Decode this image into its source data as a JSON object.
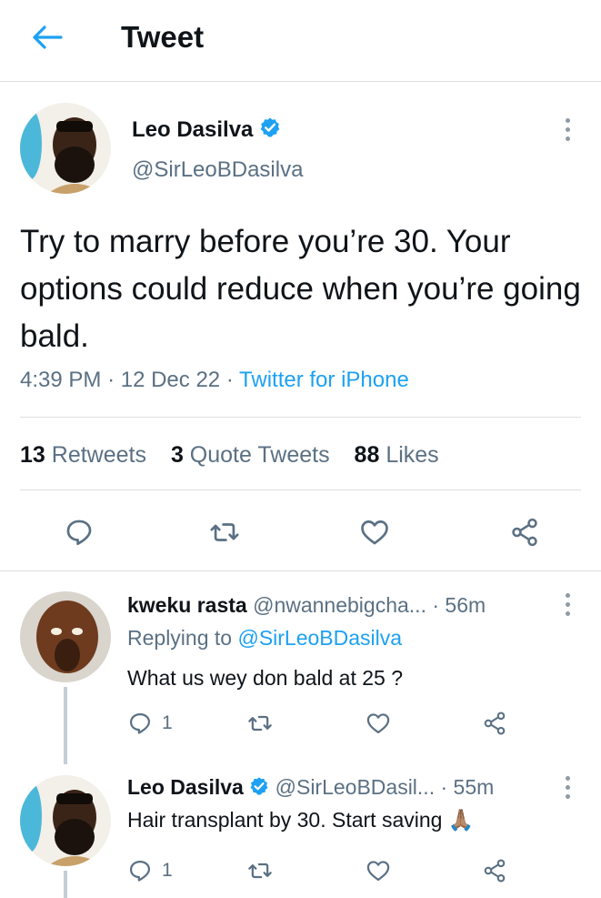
{
  "header": {
    "title": "Tweet"
  },
  "tweet": {
    "author_name": "Leo Dasilva",
    "author_handle": "@SirLeoBDasilva",
    "text": "Try to marry before you’re 30. Your options could reduce when you’re going bald.",
    "time": "4:39 PM",
    "date": "12 Dec 22",
    "sep": "·",
    "source": "Twitter for iPhone",
    "stats": {
      "retweets_count": "13",
      "retweets_label": "Retweets",
      "quotes_count": "3",
      "quotes_label": "Quote Tweets",
      "likes_count": "88",
      "likes_label": "Likes"
    }
  },
  "replies": [
    {
      "name": "kweku rasta",
      "handle": "@nwannebigcha...",
      "time": "· 56m",
      "replying_prefix": "Replying to",
      "replying_to": "@SirLeoBDasilva",
      "text": "What us wey don bald at 25 ?",
      "reply_count": "1"
    },
    {
      "name": "Leo Dasilva",
      "handle": "@SirLeoBDasil...",
      "time": "· 55m",
      "text": "Hair transplant by 30. Start saving",
      "emoji": "🙏🏽",
      "reply_count": "1"
    }
  ],
  "colors": {
    "accent": "#1da1f2",
    "muted": "#5b7083",
    "divider": "#dcdfe2"
  },
  "icons": [
    "back-arrow-icon",
    "verified-badge-icon",
    "more-options-icon",
    "reply-icon",
    "retweet-icon",
    "like-icon",
    "share-icon"
  ]
}
